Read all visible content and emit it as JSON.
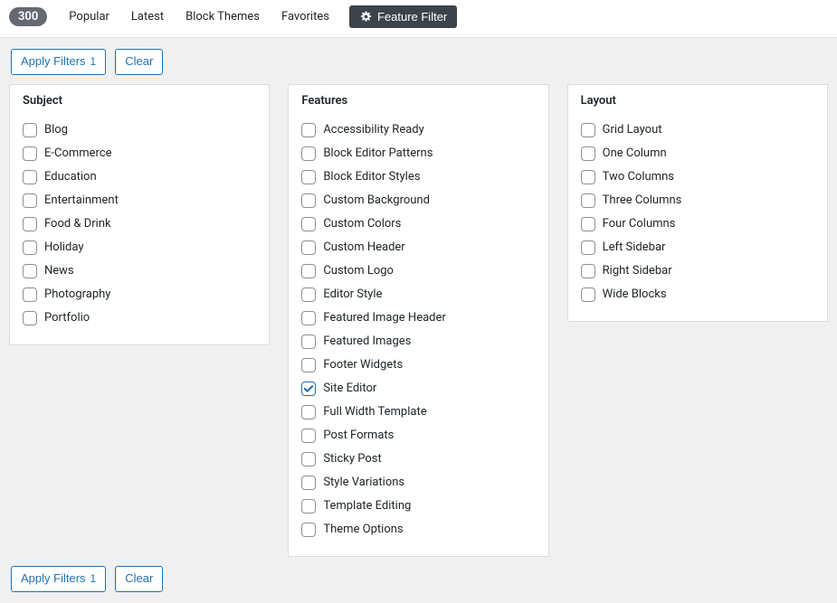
{
  "header": {
    "count": "300",
    "tabs": [
      "Popular",
      "Latest",
      "Block Themes",
      "Favorites"
    ],
    "feature_filter_label": "Feature Filter"
  },
  "actions": {
    "apply_label": "Apply Filters",
    "apply_count": "1",
    "clear_label": "Clear"
  },
  "filters": {
    "subject": {
      "title": "Subject",
      "options": [
        {
          "label": "Blog",
          "checked": false
        },
        {
          "label": "E-Commerce",
          "checked": false
        },
        {
          "label": "Education",
          "checked": false
        },
        {
          "label": "Entertainment",
          "checked": false
        },
        {
          "label": "Food & Drink",
          "checked": false
        },
        {
          "label": "Holiday",
          "checked": false
        },
        {
          "label": "News",
          "checked": false
        },
        {
          "label": "Photography",
          "checked": false
        },
        {
          "label": "Portfolio",
          "checked": false
        }
      ]
    },
    "features": {
      "title": "Features",
      "options": [
        {
          "label": "Accessibility Ready",
          "checked": false
        },
        {
          "label": "Block Editor Patterns",
          "checked": false
        },
        {
          "label": "Block Editor Styles",
          "checked": false
        },
        {
          "label": "Custom Background",
          "checked": false
        },
        {
          "label": "Custom Colors",
          "checked": false
        },
        {
          "label": "Custom Header",
          "checked": false
        },
        {
          "label": "Custom Logo",
          "checked": false
        },
        {
          "label": "Editor Style",
          "checked": false
        },
        {
          "label": "Featured Image Header",
          "checked": false
        },
        {
          "label": "Featured Images",
          "checked": false
        },
        {
          "label": "Footer Widgets",
          "checked": false
        },
        {
          "label": "Site Editor",
          "checked": true
        },
        {
          "label": "Full Width Template",
          "checked": false
        },
        {
          "label": "Post Formats",
          "checked": false
        },
        {
          "label": "Sticky Post",
          "checked": false
        },
        {
          "label": "Style Variations",
          "checked": false
        },
        {
          "label": "Template Editing",
          "checked": false
        },
        {
          "label": "Theme Options",
          "checked": false
        }
      ]
    },
    "layout": {
      "title": "Layout",
      "options": [
        {
          "label": "Grid Layout",
          "checked": false
        },
        {
          "label": "One Column",
          "checked": false
        },
        {
          "label": "Two Columns",
          "checked": false
        },
        {
          "label": "Three Columns",
          "checked": false
        },
        {
          "label": "Four Columns",
          "checked": false
        },
        {
          "label": "Left Sidebar",
          "checked": false
        },
        {
          "label": "Right Sidebar",
          "checked": false
        },
        {
          "label": "Wide Blocks",
          "checked": false
        }
      ]
    }
  }
}
